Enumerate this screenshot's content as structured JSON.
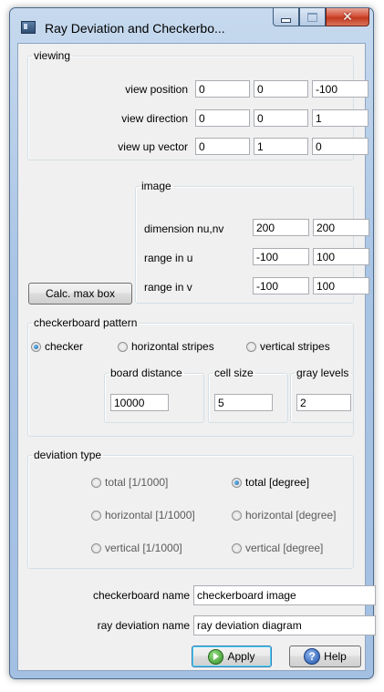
{
  "window": {
    "title": "Ray Deviation and Checkerbo..."
  },
  "viewing": {
    "legend": "viewing",
    "rows": [
      {
        "label": "view position",
        "values": [
          "0",
          "0",
          "-100"
        ]
      },
      {
        "label": "view direction",
        "values": [
          "0",
          "0",
          "1"
        ]
      },
      {
        "label": "view up vector",
        "values": [
          "0",
          "1",
          "0"
        ]
      }
    ]
  },
  "image": {
    "legend": "image",
    "rows": [
      {
        "label": "dimension nu,nv",
        "values": [
          "200",
          "200"
        ]
      },
      {
        "label": "range in u",
        "values": [
          "-100",
          "100"
        ]
      },
      {
        "label": "range in v",
        "values": [
          "-100",
          "100"
        ]
      }
    ],
    "calc_button": "Calc. max box"
  },
  "checkerboard": {
    "legend": "checkerboard pattern",
    "options": [
      "checker",
      "horizontal stripes",
      "vertical stripes"
    ],
    "selected": "checker",
    "board_distance": {
      "legend": "board distance",
      "value": "10000"
    },
    "cell_size": {
      "legend": "cell size",
      "value": "5"
    },
    "gray_levels": {
      "legend": "gray levels",
      "value": "2"
    }
  },
  "deviation": {
    "legend": "deviation type",
    "options": [
      "total [1/1000]",
      "total [degree]",
      "horizontal [1/1000]",
      "horizontal [degree]",
      "vertical [1/1000]",
      "vertical [degree]"
    ],
    "selected": "total [degree]"
  },
  "names": {
    "checkerboard_label": "checkerboard name",
    "checkerboard_value": "checkerboard image",
    "ray_label": "ray deviation name",
    "ray_value": "ray deviation diagram"
  },
  "buttons": {
    "apply": "Apply",
    "help": "Help"
  },
  "icons": {
    "app": "app-icon",
    "minimize": "minimize-icon",
    "maximize": "maximize-icon",
    "close": "close-icon",
    "apply": "play-icon",
    "help": "help-icon"
  },
  "colors": {
    "title_bar": "#a9c4e4",
    "close": "#c23a1f",
    "client": "#f0f0f0"
  }
}
